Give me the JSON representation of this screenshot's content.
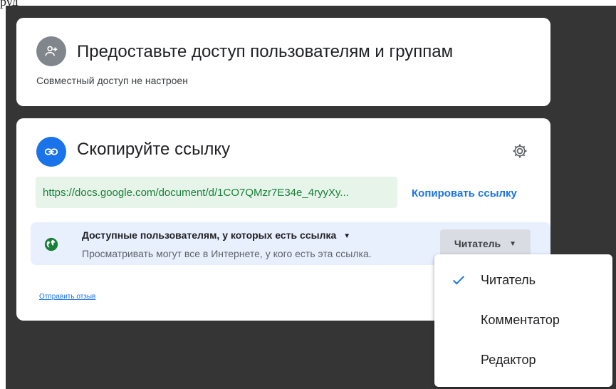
{
  "top_fragment": "руд",
  "share_card": {
    "icon": "person-add-icon",
    "title": "Предоставьте доступ пользователям и группам",
    "status": "Совместный доступ не настроен"
  },
  "link_card": {
    "icon": "link-icon",
    "title": "Скопируйте ссылку",
    "settings_icon": "gear-icon",
    "url": "https://docs.google.com/document/d/1CO7QMzr7E34e_4ryyXy...",
    "copy_label": "Копировать ссылку",
    "access": {
      "icon": "globe-icon",
      "title": "Доступные пользователям, у которых есть ссылка",
      "description": "Просматривать могут все в Интернете, у кого есть эта ссылка.",
      "role": "Читатель"
    },
    "feedback_label": "Отправить отзыв"
  },
  "role_menu": {
    "items": [
      {
        "label": "Читатель",
        "selected": true
      },
      {
        "label": "Комментатор",
        "selected": false
      },
      {
        "label": "Редактор",
        "selected": false
      }
    ]
  },
  "colors": {
    "accent": "#1a73e8",
    "url_bg": "#e6f4ea",
    "url_text": "#188038",
    "backdrop": "#353535"
  }
}
